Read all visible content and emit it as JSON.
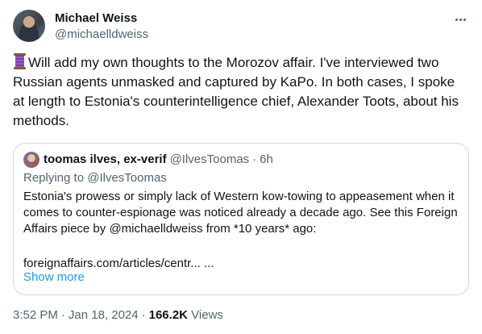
{
  "tweet": {
    "author": {
      "display_name": "Michael Weiss",
      "handle": "@michaelldweiss"
    },
    "body_emoji": "thread-spool-icon",
    "body_text": "Will add my own thoughts to the Morozov affair. I've interviewed two Russian agents unmasked and captured by KaPo. In both cases, I spoke at length to Estonia's counterintelligence chief, Alexander Toots, about his methods.",
    "time": "3:52 PM",
    "date": "Jan 18, 2024",
    "views_count": "166.2K",
    "views_label": "Views"
  },
  "quote": {
    "display_name": "toomas ilves, ex-verif",
    "handle": "@IlvesToomas",
    "time_ago": "6h",
    "replying_to": "Replying to @IlvesToomas",
    "text": "Estonia's prowess or simply lack of Western kow-towing to appeasement when it comes to counter-espionage was noticed already a decade ago. See this Foreign Affairs piece by @michaelldweiss from *10 years* ago:",
    "link": "foreignaffairs.com/articles/centr... ...",
    "show_more": "Show more"
  },
  "colors": {
    "primary_text": "#0f1419",
    "secondary_text": "#536471",
    "link": "#1d9bf0",
    "border": "#cfd9de"
  }
}
